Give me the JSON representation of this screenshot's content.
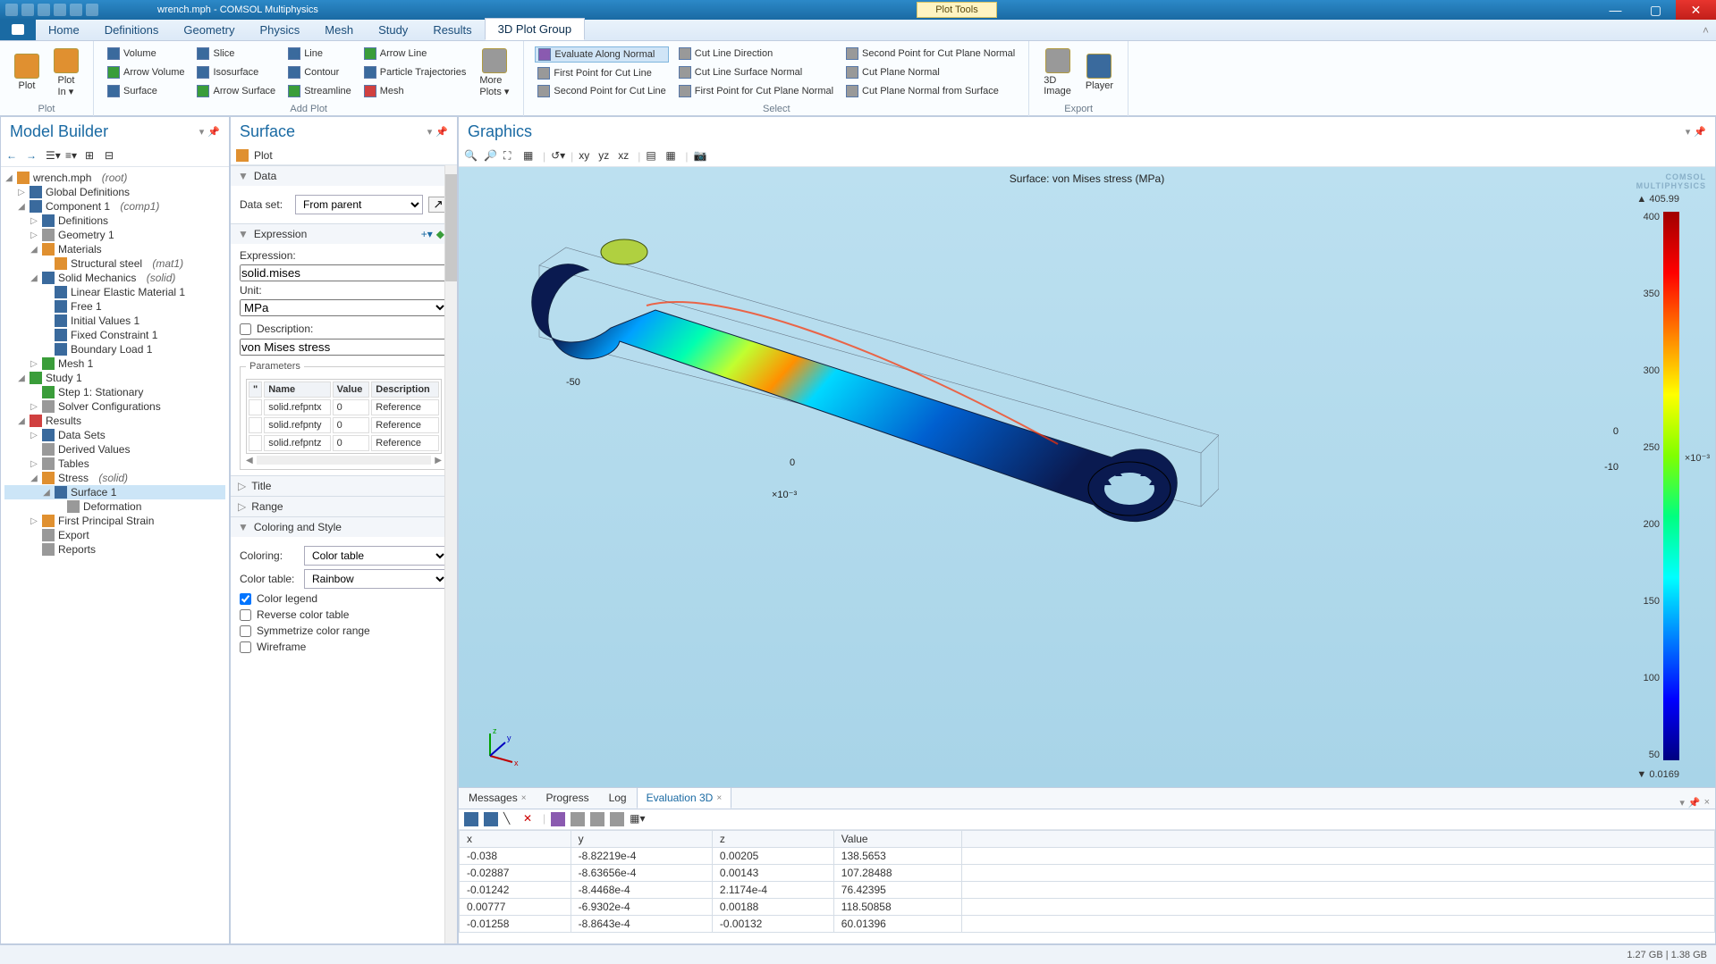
{
  "title": {
    "filename": "wrench.mph",
    "app": "COMSOL Multiphysics",
    "tooltab": "Plot Tools"
  },
  "tabs": {
    "file": "File",
    "home": "Home",
    "definitions": "Definitions",
    "geometry": "Geometry",
    "physics": "Physics",
    "mesh": "Mesh",
    "study": "Study",
    "results": "Results",
    "pg3d": "3D Plot Group"
  },
  "ribbon": {
    "plot": {
      "plot": "Plot",
      "plotin": "Plot\nIn ▾",
      "group": "Plot"
    },
    "addplot": {
      "volume": "Volume",
      "arrowvol": "Arrow Volume",
      "surface": "Surface",
      "slice": "Slice",
      "iso": "Isosurface",
      "arrowsurf": "Arrow Surface",
      "line": "Line",
      "contour": "Contour",
      "streamline": "Streamline",
      "arrowline": "Arrow Line",
      "ptraj": "Particle Trajectories",
      "meshp": "Mesh",
      "more": "More\nPlots ▾",
      "group": "Add Plot"
    },
    "select": {
      "evalnorm": "Evaluate Along Normal",
      "fp_cutline": "First Point for Cut Line",
      "sp_cutline": "Second Point for Cut Line",
      "cld": "Cut Line Direction",
      "cls_norm": "Cut Line Surface Normal",
      "fp_cpn": "First Point for Cut Plane Normal",
      "sp_cpn": "Second Point for Cut Plane Normal",
      "cpn": "Cut Plane Normal",
      "cpn_surf": "Cut Plane Normal from Surface",
      "group": "Select"
    },
    "export": {
      "img3d": "3D\nImage",
      "player": "Player",
      "group": "Export"
    }
  },
  "modelbuilder": {
    "title": "Model Builder",
    "root": "wrench.mph",
    "root_ann": "(root)",
    "gdef": "Global Definitions",
    "comp1": "Component 1",
    "comp1_ann": "(comp1)",
    "defs": "Definitions",
    "geom": "Geometry 1",
    "mats": "Materials",
    "steel": "Structural steel",
    "steel_ann": "(mat1)",
    "solid": "Solid Mechanics",
    "solid_ann": "(solid)",
    "lem": "Linear Elastic Material 1",
    "free": "Free 1",
    "initvals": "Initial Values 1",
    "fixed": "Fixed Constraint 1",
    "bload": "Boundary Load 1",
    "mesh1": "Mesh 1",
    "study1": "Study 1",
    "step1": "Step 1: Stationary",
    "solvconf": "Solver Configurations",
    "results": "Results",
    "datasets": "Data Sets",
    "derived": "Derived Values",
    "tables": "Tables",
    "stress": "Stress",
    "stress_ann": "(solid)",
    "surface1": "Surface 1",
    "deform": "Deformation",
    "fps": "First Principal Strain",
    "export": "Export",
    "reports": "Reports"
  },
  "surface": {
    "title": "Surface",
    "subplot": "Plot",
    "sections": {
      "data": "Data",
      "expr": "Expression",
      "title": "Title",
      "range": "Range",
      "color": "Coloring and Style"
    },
    "data": {
      "label": "Data set:",
      "value": "From parent"
    },
    "expr": {
      "label": "Expression:",
      "value": "solid.mises",
      "unitlabel": "Unit:",
      "unit": "MPa",
      "desclabel": "Description:",
      "desc": "von Mises stress",
      "paramlabel": "Parameters",
      "cols": {
        "name": "Name",
        "value": "Value",
        "desc": "Description"
      },
      "rows": [
        {
          "n": "solid.refpntx",
          "v": "0",
          "d": "Reference"
        },
        {
          "n": "solid.refpnty",
          "v": "0",
          "d": "Reference"
        },
        {
          "n": "solid.refpntz",
          "v": "0",
          "d": "Reference"
        }
      ]
    },
    "color": {
      "coloringlabel": "Coloring:",
      "coloring": "Color table",
      "ctablelabel": "Color table:",
      "ctable": "Rainbow",
      "legend": "Color legend",
      "reverse": "Reverse color table",
      "symm": "Symmetrize color range",
      "wire": "Wireframe"
    }
  },
  "graphics": {
    "title": "Graphics",
    "surftitle": "Surface: von Mises stress (MPa)",
    "logo1": "COMSOL",
    "logo2": "MULTIPHYSICS",
    "cbmax": "▲ 405.99",
    "cbmin": "▼ 0.0169",
    "cbticks": [
      "400",
      "350",
      "300",
      "250",
      "200",
      "150",
      "100",
      "50"
    ],
    "cbunit": "×10⁻³",
    "axis": {
      "m50": "-50",
      "zero": "0",
      "zero2": "0",
      "m10": "-10",
      "e3": "×10⁻³"
    },
    "triad": {
      "x": "x",
      "y": "y",
      "z": "z"
    }
  },
  "bottom": {
    "tabs": {
      "msg": "Messages",
      "prog": "Progress",
      "log": "Log",
      "eval3d": "Evaluation 3D"
    },
    "cols": {
      "x": "x",
      "y": "y",
      "z": "z",
      "val": "Value"
    },
    "rows": [
      {
        "x": "-0.038",
        "y": "-8.82219e-4",
        "z": "0.00205",
        "v": "138.5653"
      },
      {
        "x": "-0.02887",
        "y": "-8.63656e-4",
        "z": "0.00143",
        "v": "107.28488"
      },
      {
        "x": "-0.01242",
        "y": "-8.4468e-4",
        "z": "2.1174e-4",
        "v": "76.42395"
      },
      {
        "x": "0.00777",
        "y": "-6.9302e-4",
        "z": "0.00188",
        "v": "118.50858"
      },
      {
        "x": "-0.01258",
        "y": "-8.8643e-4",
        "z": "-0.00132",
        "v": "60.01396"
      }
    ]
  },
  "status": {
    "mem": "1.27 GB | 1.38 GB"
  }
}
